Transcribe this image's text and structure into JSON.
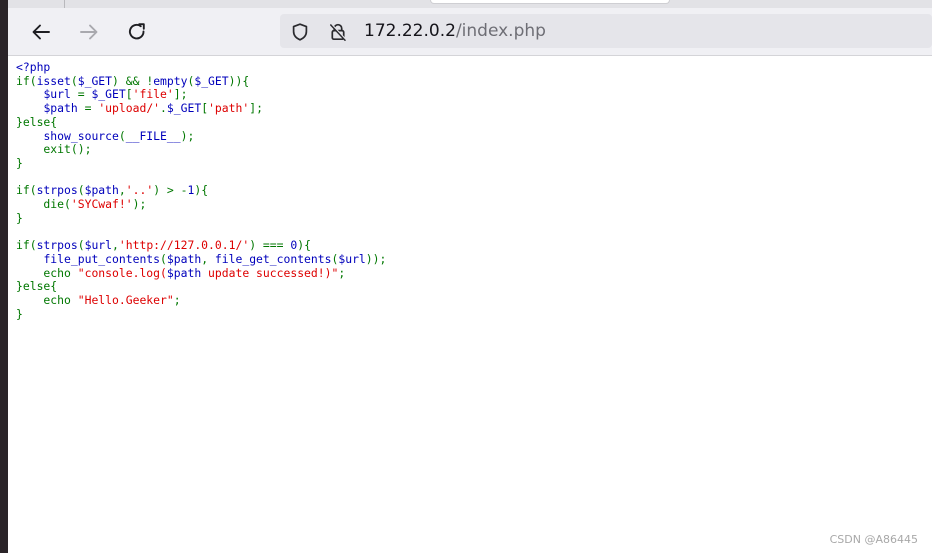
{
  "browser": {
    "url_host": "172.22.0.2",
    "url_path": "/index.php",
    "icons": {
      "back": "arrow-left-icon",
      "forward": "arrow-right-icon",
      "reload": "reload-icon",
      "tracking": "shield-icon",
      "insecure": "crossed-lock-icon"
    }
  },
  "source_code": {
    "lines": [
      [
        {
          "t": "<?php",
          "c": "default"
        }
      ],
      [
        {
          "t": "if(",
          "c": "kw"
        },
        {
          "t": "isset",
          "c": "default"
        },
        {
          "t": "(",
          "c": "kw"
        },
        {
          "t": "$_GET",
          "c": "default"
        },
        {
          "t": ") && !",
          "c": "kw"
        },
        {
          "t": "empty",
          "c": "default"
        },
        {
          "t": "(",
          "c": "kw"
        },
        {
          "t": "$_GET",
          "c": "default"
        },
        {
          "t": ")){",
          "c": "kw"
        }
      ],
      [
        {
          "t": "    ",
          "c": "default"
        },
        {
          "t": "$url ",
          "c": "default"
        },
        {
          "t": "= ",
          "c": "kw"
        },
        {
          "t": "$_GET",
          "c": "default"
        },
        {
          "t": "[",
          "c": "kw"
        },
        {
          "t": "'file'",
          "c": "str"
        },
        {
          "t": "];",
          "c": "kw"
        }
      ],
      [
        {
          "t": "    ",
          "c": "default"
        },
        {
          "t": "$path ",
          "c": "default"
        },
        {
          "t": "= ",
          "c": "kw"
        },
        {
          "t": "'upload/'",
          "c": "str"
        },
        {
          "t": ".",
          "c": "kw"
        },
        {
          "t": "$_GET",
          "c": "default"
        },
        {
          "t": "[",
          "c": "kw"
        },
        {
          "t": "'path'",
          "c": "str"
        },
        {
          "t": "];",
          "c": "kw"
        }
      ],
      [
        {
          "t": "}else{",
          "c": "kw"
        }
      ],
      [
        {
          "t": "    ",
          "c": "default"
        },
        {
          "t": "show_source",
          "c": "default"
        },
        {
          "t": "(",
          "c": "kw"
        },
        {
          "t": "__FILE__",
          "c": "default"
        },
        {
          "t": ");",
          "c": "kw"
        }
      ],
      [
        {
          "t": "    exit();",
          "c": "kw"
        }
      ],
      [
        {
          "t": "}",
          "c": "kw"
        }
      ],
      [
        {
          "t": "",
          "c": "default"
        }
      ],
      [
        {
          "t": "if(",
          "c": "kw"
        },
        {
          "t": "strpos",
          "c": "default"
        },
        {
          "t": "(",
          "c": "kw"
        },
        {
          "t": "$path",
          "c": "default"
        },
        {
          "t": ",",
          "c": "kw"
        },
        {
          "t": "'..'",
          "c": "str"
        },
        {
          "t": ") > -",
          "c": "kw"
        },
        {
          "t": "1",
          "c": "default"
        },
        {
          "t": "){",
          "c": "kw"
        }
      ],
      [
        {
          "t": "    die(",
          "c": "kw"
        },
        {
          "t": "'SYCwaf!'",
          "c": "str"
        },
        {
          "t": ");",
          "c": "kw"
        }
      ],
      [
        {
          "t": "}",
          "c": "kw"
        }
      ],
      [
        {
          "t": "",
          "c": "default"
        }
      ],
      [
        {
          "t": "if(",
          "c": "kw"
        },
        {
          "t": "strpos",
          "c": "default"
        },
        {
          "t": "(",
          "c": "kw"
        },
        {
          "t": "$url",
          "c": "default"
        },
        {
          "t": ",",
          "c": "kw"
        },
        {
          "t": "'http://127.0.0.1/'",
          "c": "str"
        },
        {
          "t": ") === ",
          "c": "kw"
        },
        {
          "t": "0",
          "c": "default"
        },
        {
          "t": "){",
          "c": "kw"
        }
      ],
      [
        {
          "t": "    ",
          "c": "default"
        },
        {
          "t": "file_put_contents",
          "c": "default"
        },
        {
          "t": "(",
          "c": "kw"
        },
        {
          "t": "$path",
          "c": "default"
        },
        {
          "t": ", ",
          "c": "kw"
        },
        {
          "t": "file_get_contents",
          "c": "default"
        },
        {
          "t": "(",
          "c": "kw"
        },
        {
          "t": "$url",
          "c": "default"
        },
        {
          "t": "));",
          "c": "kw"
        }
      ],
      [
        {
          "t": "    echo ",
          "c": "kw"
        },
        {
          "t": "\"console.log(",
          "c": "str"
        },
        {
          "t": "$path",
          "c": "default"
        },
        {
          "t": " update successed!)\"",
          "c": "str"
        },
        {
          "t": ";",
          "c": "kw"
        }
      ],
      [
        {
          "t": "}else{",
          "c": "kw"
        }
      ],
      [
        {
          "t": "    echo ",
          "c": "kw"
        },
        {
          "t": "\"Hello.Geeker\"",
          "c": "str"
        },
        {
          "t": ";",
          "c": "kw"
        }
      ],
      [
        {
          "t": "}",
          "c": "kw"
        }
      ]
    ]
  },
  "watermark": "CSDN @A86445"
}
